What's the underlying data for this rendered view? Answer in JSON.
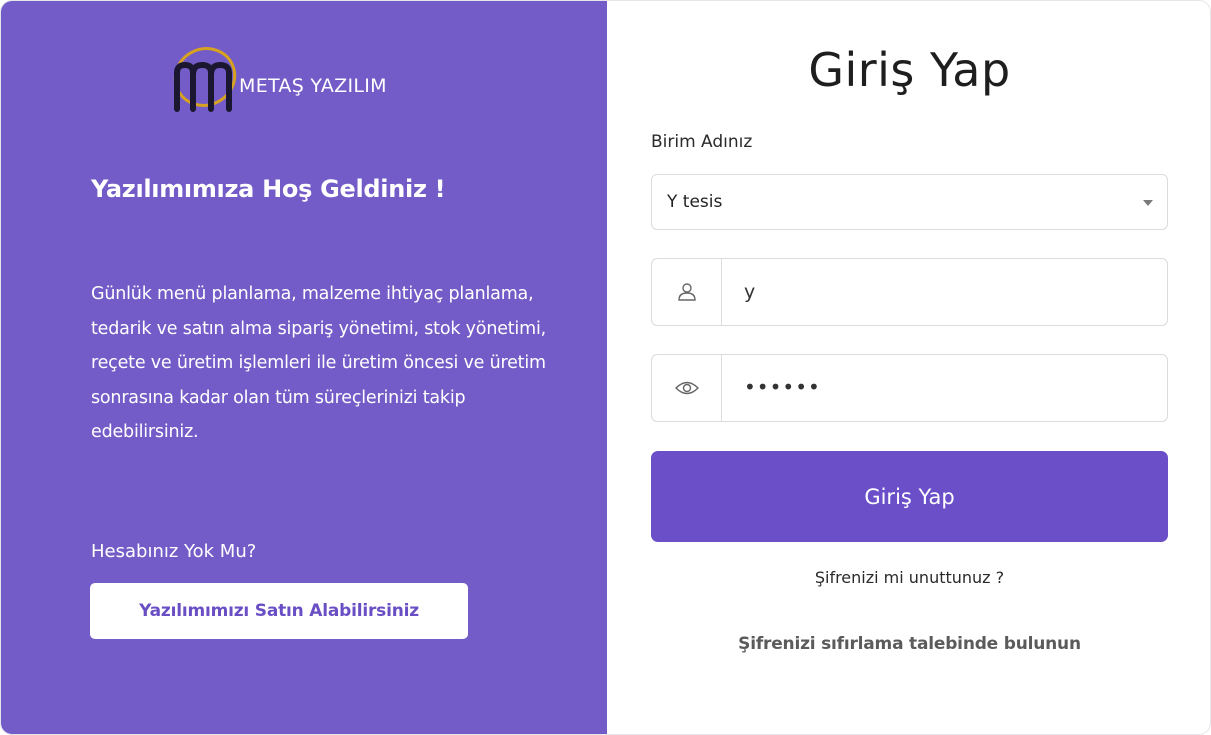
{
  "colors": {
    "left_panel": "#735cc7",
    "primary_button": "#6a4fc8",
    "buy_button_text": "#6a4fc4"
  },
  "brand": {
    "name": "METAŞ YAZILIM",
    "logo_icon": "m-ring-logo"
  },
  "left": {
    "welcome": "Yazılımımıza Hoş Geldiniz !",
    "description": "Günlük menü planlama, malzeme ihtiyaç planlama, tedarik ve satın alma sipariş yönetimi, stok yönetimi, reçete ve üretim işlemleri ile üretim öncesi ve üretim sonrasına kadar olan tüm süreçlerinizi takip edebilirsiniz.",
    "no_account": "Hesabınız Yok Mu?",
    "buy_button": "Yazılımımızı Satın Alabilirsiniz"
  },
  "login": {
    "title": "Giriş Yap",
    "unit_label": "Birim Adınız",
    "unit_selected": "Y tesis",
    "username_icon": "user-icon",
    "username_value": "y",
    "password_icon": "eye-icon",
    "password_value": "••••••",
    "submit_label": "Giriş Yap",
    "forgot_text": "Şifrenizi mi unuttunuz ?",
    "reset_link": "Şifrenizi sıfırlama talebinde bulunun"
  }
}
